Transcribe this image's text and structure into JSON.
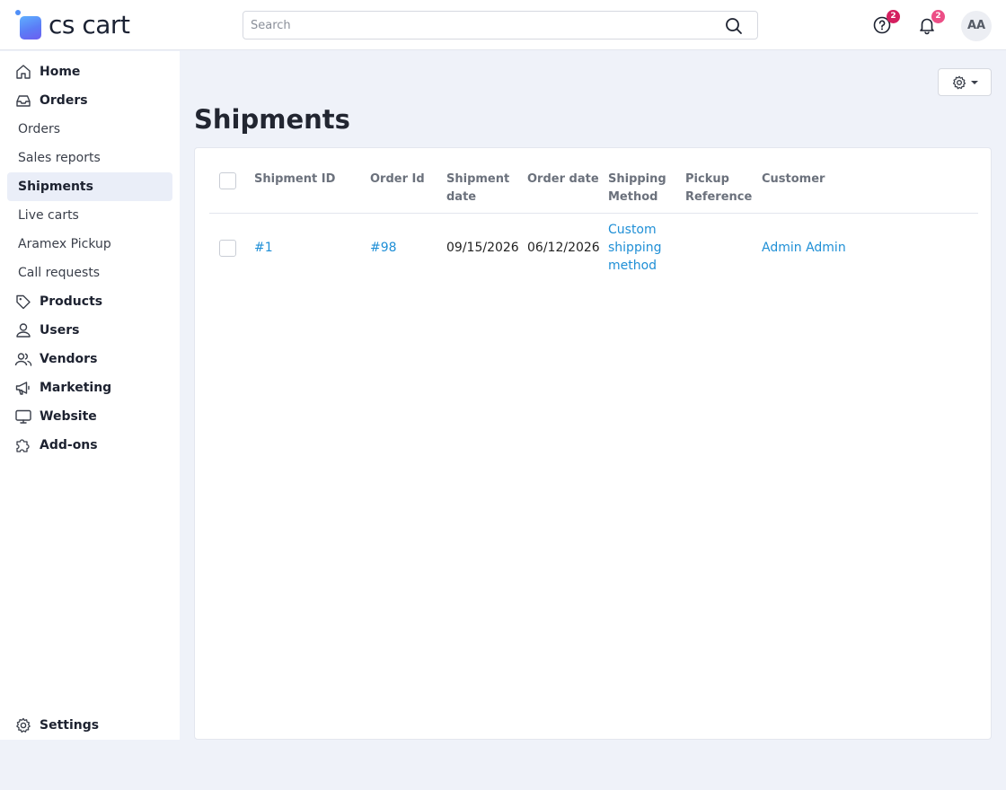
{
  "brand": {
    "name": "cs cart"
  },
  "search": {
    "placeholder": "Search"
  },
  "header": {
    "help_badge": "2",
    "notifications_badge": "2",
    "avatar_initials": "AA",
    "badge_colors": {
      "help": "#d41f5f",
      "notifications": "#ec4e86"
    }
  },
  "sidebar": {
    "items": [
      {
        "label": "Home",
        "icon": "home-icon"
      },
      {
        "label": "Orders",
        "icon": "inbox-icon"
      },
      {
        "label": "Orders"
      },
      {
        "label": "Sales reports"
      },
      {
        "label": "Shipments",
        "active": true
      },
      {
        "label": "Live carts"
      },
      {
        "label": "Aramex Pickup"
      },
      {
        "label": "Call requests"
      },
      {
        "label": "Products",
        "icon": "tag-icon"
      },
      {
        "label": "Users",
        "icon": "user-icon"
      },
      {
        "label": "Vendors",
        "icon": "users-icon"
      },
      {
        "label": "Marketing",
        "icon": "megaphone-icon"
      },
      {
        "label": "Website",
        "icon": "monitor-icon"
      },
      {
        "label": "Add-ons",
        "icon": "puzzle-icon"
      }
    ],
    "settings_label": "Settings"
  },
  "page": {
    "title": "Shipments"
  },
  "table": {
    "columns": [
      "Shipment ID",
      "Order Id",
      "Shipment\ndate",
      "Order date",
      "Shipping\nMethod",
      "Pickup\nReference",
      "Customer"
    ],
    "col_shipment_id": "Shipment ID",
    "col_order_id": "Order Id",
    "col_shipment_date_1": "Shipment",
    "col_shipment_date_2": "date",
    "col_order_date": "Order date",
    "col_shipping_method_1": "Shipping",
    "col_shipping_method_2": "Method",
    "col_pickup_reference_1": "Pickup",
    "col_pickup_reference_2": "Reference",
    "col_customer": "Customer",
    "rows": [
      {
        "shipment_id": "#1",
        "order_id": "#98",
        "shipment_date": "09/15/2026",
        "order_date": "06/12/2026",
        "shipping_method_1": "Custom",
        "shipping_method_2": "shipping",
        "shipping_method_3": "method",
        "pickup_reference": "",
        "customer": "Admin Admin"
      }
    ]
  },
  "colors": {
    "link": "#1f8fd6",
    "active_bg": "#eaeef8",
    "page_bg": "#eff2f9"
  }
}
